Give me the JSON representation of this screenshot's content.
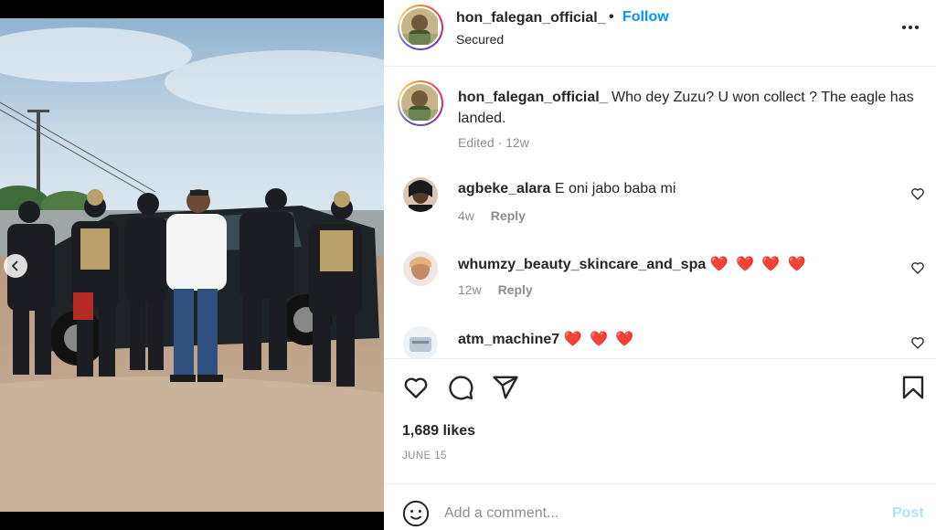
{
  "post": {
    "username": "hon_falegan_official_",
    "follow_label": "Follow",
    "separator": "•",
    "subtitle": "Secured",
    "caption_text": "Who dey Zuzu? U won collect ? The eagle has landed.",
    "caption_meta": "Edited · 12w"
  },
  "comments": [
    {
      "username": "agbeke_alara",
      "text": "E oni jabo baba mi",
      "age": "4w",
      "reply_label": "Reply"
    },
    {
      "username": "whumzy_beauty_skincare_and_spa",
      "text": "❤️ ❤️ ❤️ ❤️",
      "age": "12w",
      "reply_label": "Reply"
    },
    {
      "username": "atm_machine7",
      "text": "❤️ ❤️ ❤️",
      "age": "",
      "reply_label": ""
    }
  ],
  "actions": {
    "icons": [
      "heart-icon",
      "comment-icon",
      "share-icon",
      "save-icon"
    ],
    "likes": "1,689 likes",
    "date": "JUNE 15"
  },
  "add_comment": {
    "placeholder": "Add a comment...",
    "post_label": "Post"
  },
  "colors": {
    "link_blue": "#0095f6",
    "post_disabled": "#b2dffc",
    "heart_red": "#ed2a2a",
    "muted_text": "#8e8e8e"
  }
}
